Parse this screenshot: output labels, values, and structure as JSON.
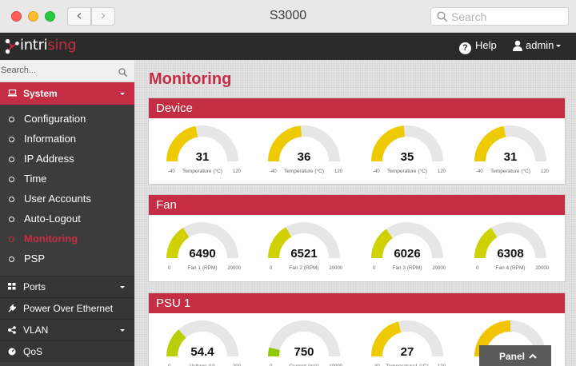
{
  "window": {
    "title": "S3000",
    "search_placeholder": "Search",
    "back_glyph": "‹",
    "forward_glyph": "›"
  },
  "header": {
    "logo_main": "intri",
    "logo_accent": "sing",
    "help_label": "Help",
    "user_label": "admin"
  },
  "sidebar": {
    "search_placeholder": "Search...",
    "system_label": "System",
    "system_items": [
      {
        "label": "Configuration",
        "active": false
      },
      {
        "label": "Information",
        "active": false
      },
      {
        "label": "IP Address",
        "active": false
      },
      {
        "label": "Time",
        "active": false
      },
      {
        "label": "User Accounts",
        "active": false
      },
      {
        "label": "Auto-Logout",
        "active": false
      },
      {
        "label": "Monitoring",
        "active": true
      },
      {
        "label": "PSP",
        "active": false
      }
    ],
    "groups": [
      {
        "label": "Ports",
        "icon": "grid-icon",
        "expandable": true
      },
      {
        "label": "Power Over Ethernet",
        "icon": "plug-icon",
        "expandable": false
      },
      {
        "label": "VLAN",
        "icon": "share-icon",
        "expandable": true
      },
      {
        "label": "QoS",
        "icon": "gauge-icon",
        "expandable": false
      }
    ]
  },
  "main": {
    "title": "Monitoring",
    "panels": [
      {
        "title": "Device",
        "gauges": [
          {
            "value": "31",
            "label": "Temperature (°C)",
            "min": "-40",
            "max": "120",
            "level": 0.44,
            "color": "#eecb00"
          },
          {
            "value": "36",
            "label": "Temperature (°C)",
            "min": "-40",
            "max": "120",
            "level": 0.47,
            "color": "#eecb00"
          },
          {
            "value": "35",
            "label": "Temperature (°C)",
            "min": "-40",
            "max": "120",
            "level": 0.47,
            "color": "#eecb00"
          },
          {
            "value": "31",
            "label": "Temperature (°C)",
            "min": "-40",
            "max": "120",
            "level": 0.44,
            "color": "#eecb00"
          }
        ]
      },
      {
        "title": "Fan",
        "gauges": [
          {
            "value": "6490",
            "label": "Fan 1 (RPM)",
            "min": "0",
            "max": "20000",
            "level": 0.32,
            "color": "#cfd200"
          },
          {
            "value": "6521",
            "label": "Fan 2 (RPM)",
            "min": "0",
            "max": "20000",
            "level": 0.33,
            "color": "#cfd200"
          },
          {
            "value": "6026",
            "label": "Fan 3 (RPM)",
            "min": "0",
            "max": "20000",
            "level": 0.3,
            "color": "#cfd200"
          },
          {
            "value": "6308",
            "label": "Fan 4 (RPM)",
            "min": "0",
            "max": "20000",
            "level": 0.32,
            "color": "#cfd200"
          }
        ]
      },
      {
        "title": "PSU 1",
        "gauges": [
          {
            "value": "54.4",
            "label": "Voltage (V)",
            "min": "0",
            "max": "200",
            "level": 0.27,
            "color": "#b9cf0c"
          },
          {
            "value": "750",
            "label": "Current (mA)",
            "min": "0",
            "max": "10000",
            "level": 0.08,
            "color": "#8fc900"
          },
          {
            "value": "27",
            "label": "Temperature1 (°C)",
            "min": "-40",
            "max": "120",
            "level": 0.42,
            "color": "#eecb00"
          },
          {
            "value": "",
            "label": "",
            "min": "",
            "max": "",
            "level": 0.5,
            "color": "#f2c400"
          }
        ]
      }
    ]
  },
  "floating_tab": {
    "label": "Panel"
  }
}
